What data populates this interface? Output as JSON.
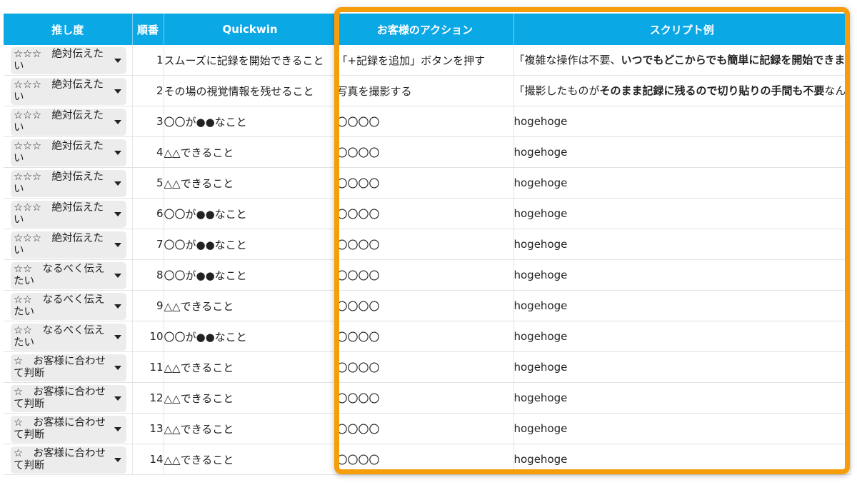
{
  "headers": {
    "priority": "推し度",
    "order": "順番",
    "quickwin": "Quickwin",
    "action": "お客様のアクション",
    "script": "スクリプト例"
  },
  "rows": [
    {
      "priority": "☆☆☆　絶対伝えたい",
      "no": "1",
      "quickwin": "スムーズに記録を開始できること",
      "action": "「+記録を追加」ボタンを押す",
      "script_plain": "「複雑な操作は不要、",
      "script_bold": "いつでもどこからでも簡単に記録を開始できます！",
      "script_tail": "」"
    },
    {
      "priority": "☆☆☆　絶対伝えたい",
      "no": "2",
      "quickwin": "その場の視覚情報を残せること",
      "action": "写真を撮影する",
      "script_plain": "「撮影したものが",
      "script_bold": "そのまま記録に残るので切り貼りの手間も不要",
      "script_tail": "なんです！」"
    },
    {
      "priority": "☆☆☆　絶対伝えたい",
      "no": "3",
      "quickwin": "〇〇が●●なこと",
      "action": "〇〇〇〇",
      "script": "hogehoge"
    },
    {
      "priority": "☆☆☆　絶対伝えたい",
      "no": "4",
      "quickwin": "△△できること",
      "action": "〇〇〇〇",
      "script": "hogehoge"
    },
    {
      "priority": "☆☆☆　絶対伝えたい",
      "no": "5",
      "quickwin": "△△できること",
      "action": "〇〇〇〇",
      "script": "hogehoge"
    },
    {
      "priority": "☆☆☆　絶対伝えたい",
      "no": "6",
      "quickwin": "〇〇が●●なこと",
      "action": "〇〇〇〇",
      "script": "hogehoge"
    },
    {
      "priority": "☆☆☆　絶対伝えたい",
      "no": "7",
      "quickwin": "〇〇が●●なこと",
      "action": "〇〇〇〇",
      "script": "hogehoge"
    },
    {
      "priority": "☆☆　なるべく伝えたい",
      "no": "8",
      "quickwin": "〇〇が●●なこと",
      "action": "〇〇〇〇",
      "script": "hogehoge"
    },
    {
      "priority": "☆☆　なるべく伝えたい",
      "no": "9",
      "quickwin": "△△できること",
      "action": "〇〇〇〇",
      "script": "hogehoge"
    },
    {
      "priority": "☆☆　なるべく伝えたい",
      "no": "10",
      "quickwin": "〇〇が●●なこと",
      "action": "〇〇〇〇",
      "script": "hogehoge"
    },
    {
      "priority": "☆　お客様に合わせて判断",
      "no": "11",
      "quickwin": "△△できること",
      "action": "〇〇〇〇",
      "script": "hogehoge"
    },
    {
      "priority": "☆　お客様に合わせて判断",
      "no": "12",
      "quickwin": "△△できること",
      "action": "〇〇〇〇",
      "script": "hogehoge"
    },
    {
      "priority": "☆　お客様に合わせて判断",
      "no": "13",
      "quickwin": "△△できること",
      "action": "〇〇〇〇",
      "script": "hogehoge"
    },
    {
      "priority": "☆　お客様に合わせて判断",
      "no": "14",
      "quickwin": "△△できること",
      "action": "〇〇〇〇",
      "script": "hogehoge"
    }
  ],
  "colors": {
    "header_bg": "#0ba8e6",
    "highlight": "#f59d0b"
  },
  "icons": {
    "dropdown": "chevron-down-icon"
  }
}
